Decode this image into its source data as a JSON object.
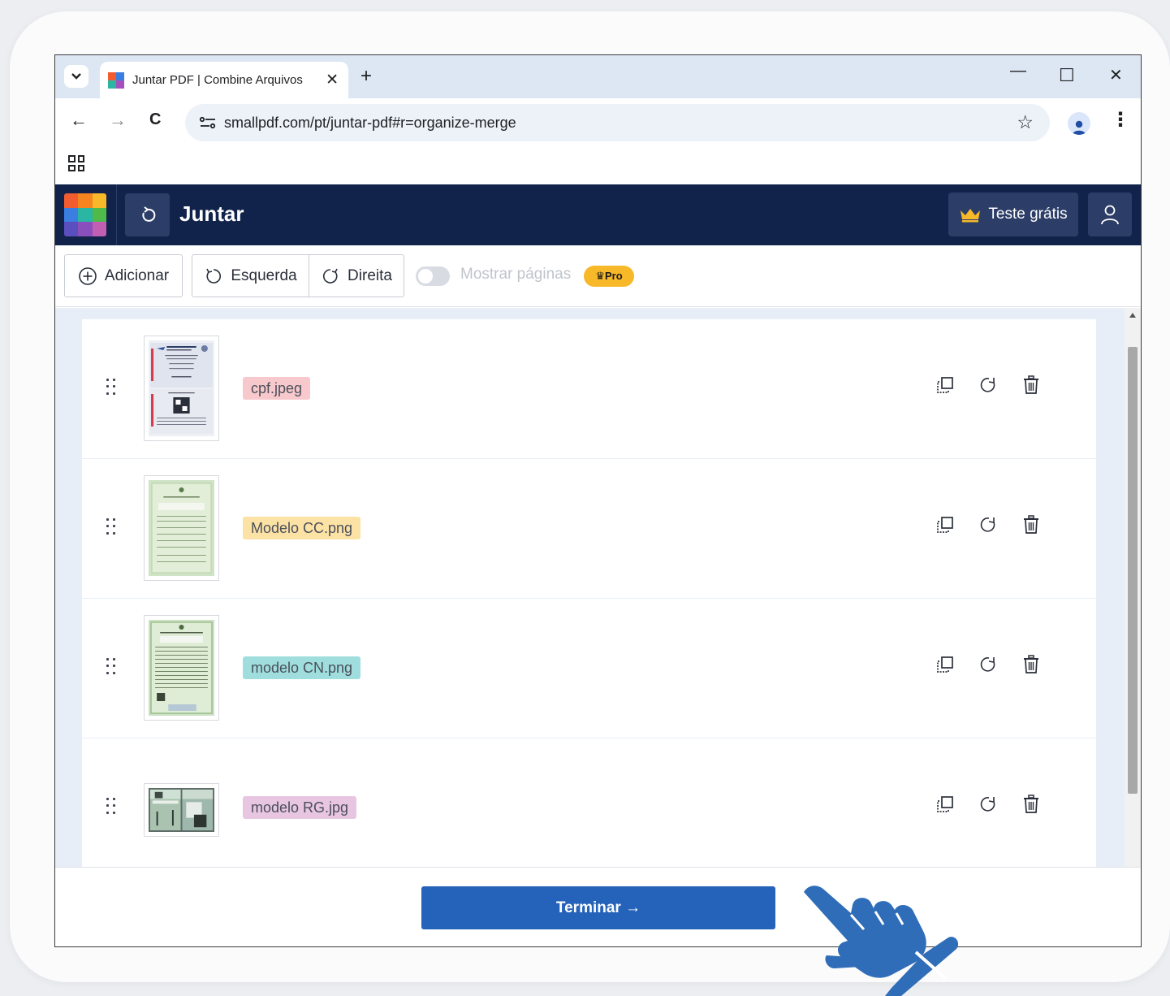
{
  "browser": {
    "tab_title": "Juntar PDF | Combine Arquivos",
    "tab_close": "✕",
    "new_tab": "+",
    "url": "smallpdf.com/pt/juntar-pdf#r=organize-merge",
    "minimize": "—",
    "maximize": "☐",
    "close": "✕",
    "back": "←",
    "forward": "→",
    "reload": "C",
    "bookmark": "☆"
  },
  "app": {
    "title": "Juntar",
    "trial_label": "Teste grátis",
    "undo_icon": "↻"
  },
  "toolbar": {
    "add_label": "Adicionar",
    "left_label": "Esquerda",
    "right_label": "Direita",
    "toggle_label": "Mostrar páginas",
    "pro_label": "♛Pro"
  },
  "files": [
    {
      "name": "cpf.jpeg",
      "tag_color": "#f7c9cd"
    },
    {
      "name": "Modelo CC.png",
      "tag_color": "#fde2a6"
    },
    {
      "name": "modelo CN.png",
      "tag_color": "#9fdedd"
    },
    {
      "name": "modelo RG.jpg",
      "tag_color": "#e8c6e1"
    }
  ],
  "footer": {
    "finish_label": "Terminar →"
  },
  "colors": {
    "header_bg": "#12234b",
    "accent": "#2562b9",
    "pro_badge": "#f7b829"
  }
}
